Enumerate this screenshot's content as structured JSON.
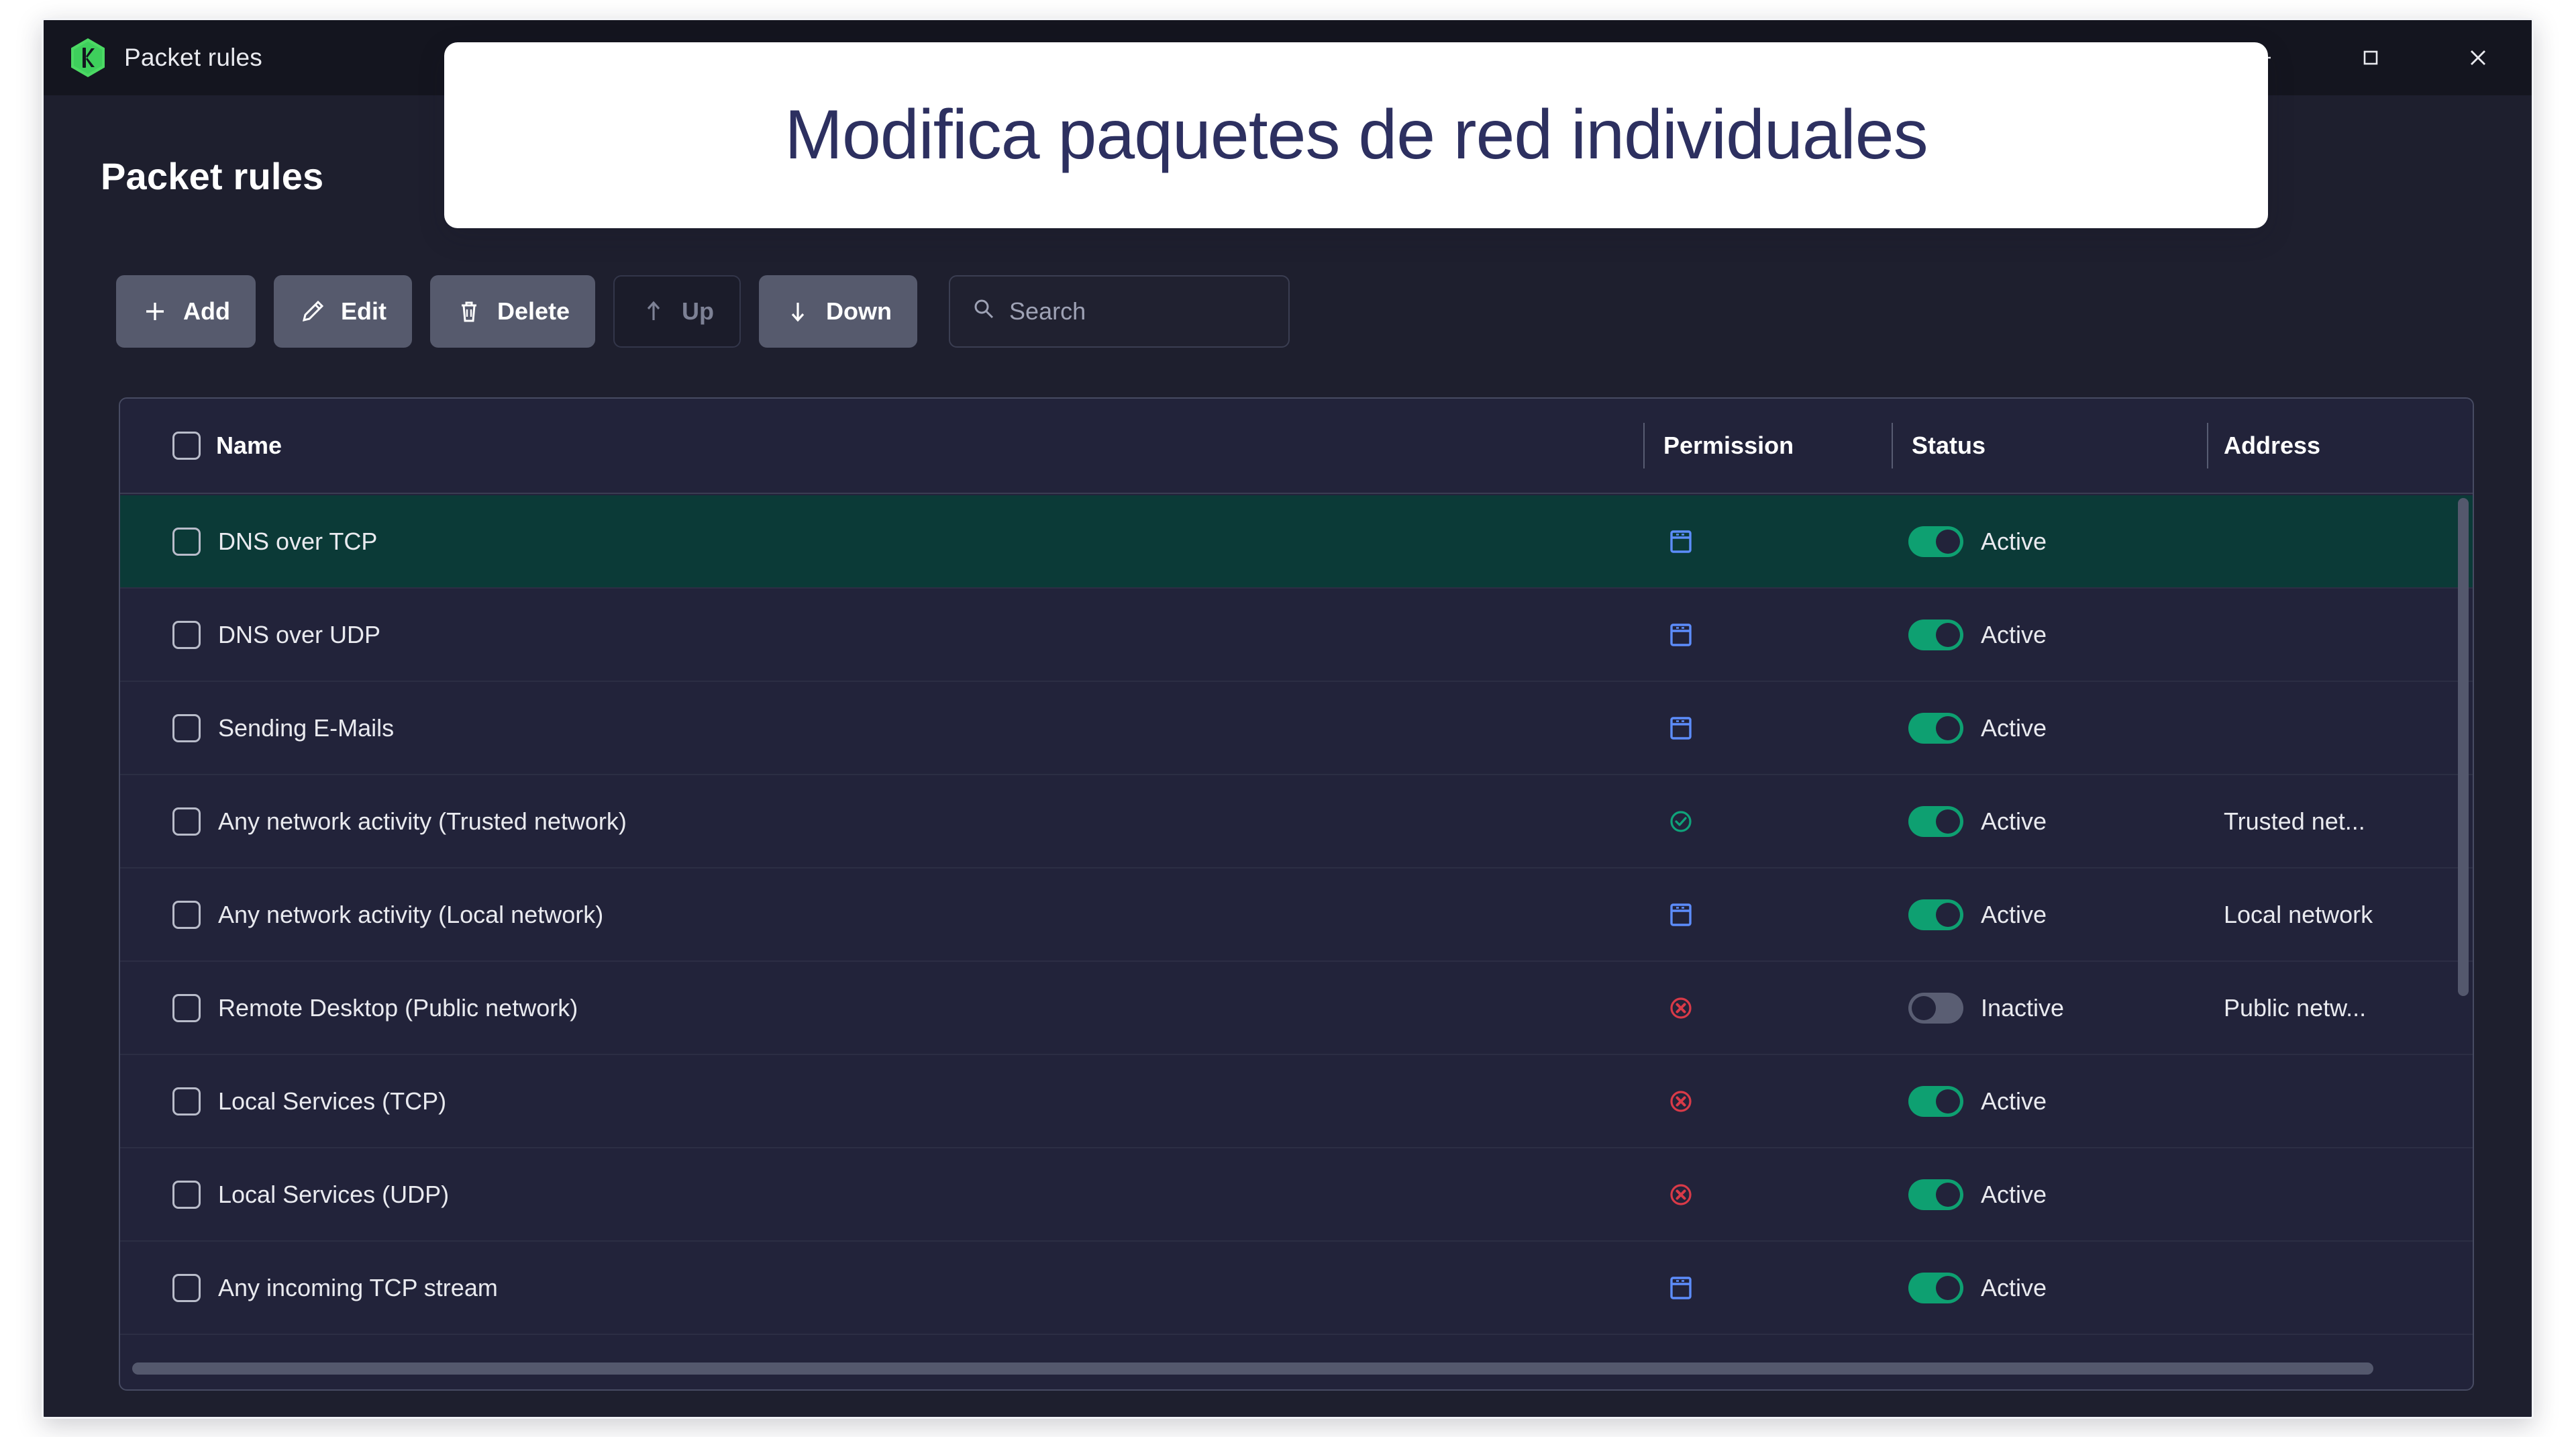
{
  "window": {
    "title": "Packet rules",
    "logo_icon": "kaspersky-hexagon-k-icon",
    "controls": [
      {
        "name": "minimize",
        "icon": "minimize-icon"
      },
      {
        "name": "maximize",
        "icon": "maximize-icon"
      },
      {
        "name": "close",
        "icon": "close-icon"
      }
    ]
  },
  "page": {
    "heading": "Packet rules"
  },
  "toolbar": {
    "buttons": [
      {
        "label": "Add",
        "icon": "plus-icon",
        "disabled": false
      },
      {
        "label": "Edit",
        "icon": "pencil-icon",
        "disabled": false
      },
      {
        "label": "Delete",
        "icon": "trash-icon",
        "disabled": false
      },
      {
        "label": "Up",
        "icon": "arrow-up-icon",
        "disabled": true
      },
      {
        "label": "Down",
        "icon": "arrow-down-icon",
        "disabled": false
      }
    ],
    "search": {
      "placeholder": "Search",
      "value": "",
      "icon": "search-icon"
    }
  },
  "table": {
    "columns": [
      {
        "key": "name",
        "label": "Name"
      },
      {
        "key": "permission",
        "label": "Permission"
      },
      {
        "key": "status",
        "label": "Status"
      },
      {
        "key": "address",
        "label": "Address"
      }
    ],
    "select_all_checked": false,
    "rows": [
      {
        "name": "DNS over TCP",
        "checked": false,
        "permission": "prompt",
        "permission_icon": "window-prompt-icon",
        "status": "Active",
        "status_on": true,
        "address": "",
        "selected": true
      },
      {
        "name": "DNS over UDP",
        "checked": false,
        "permission": "prompt",
        "permission_icon": "window-prompt-icon",
        "status": "Active",
        "status_on": true,
        "address": "",
        "selected": false
      },
      {
        "name": "Sending E-Mails",
        "checked": false,
        "permission": "prompt",
        "permission_icon": "window-prompt-icon",
        "status": "Active",
        "status_on": true,
        "address": "",
        "selected": false
      },
      {
        "name": "Any network activity (Trusted network)",
        "checked": false,
        "permission": "allow",
        "permission_icon": "check-circle-icon",
        "status": "Active",
        "status_on": true,
        "address": "Trusted net...",
        "selected": false
      },
      {
        "name": "Any network activity (Local network)",
        "checked": false,
        "permission": "prompt",
        "permission_icon": "window-prompt-icon",
        "status": "Active",
        "status_on": true,
        "address": "Local network",
        "selected": false
      },
      {
        "name": "Remote Desktop (Public network)",
        "checked": false,
        "permission": "block",
        "permission_icon": "block-circle-icon",
        "status": "Inactive",
        "status_on": false,
        "address": "Public netw...",
        "selected": false
      },
      {
        "name": "Local Services (TCP)",
        "checked": false,
        "permission": "block",
        "permission_icon": "block-circle-icon",
        "status": "Active",
        "status_on": true,
        "address": "",
        "selected": false
      },
      {
        "name": "Local Services (UDP)",
        "checked": false,
        "permission": "block",
        "permission_icon": "block-circle-icon",
        "status": "Active",
        "status_on": true,
        "address": "",
        "selected": false
      },
      {
        "name": "Any incoming TCP stream",
        "checked": false,
        "permission": "prompt",
        "permission_icon": "window-prompt-icon",
        "status": "Active",
        "status_on": true,
        "address": "",
        "selected": false
      }
    ]
  },
  "scrollbars": {
    "vertical_icon": "vertical-scrollbar",
    "horizontal_icon": "horizontal-scrollbar"
  },
  "callout": {
    "text": "Modifica paquetes de red individuales"
  },
  "colors": {
    "accent_green": "#0ea071",
    "selected_row": "#0b3a37",
    "permission_prompt": "#5d8dfc",
    "permission_allow": "#0fa37a",
    "permission_block": "#d93a48",
    "button_bg": "#565a6d",
    "callout_text": "#2d3060",
    "window_bg": "#1e1f2e",
    "table_bg": "#22233a",
    "titlebar_bg": "#14151f"
  }
}
